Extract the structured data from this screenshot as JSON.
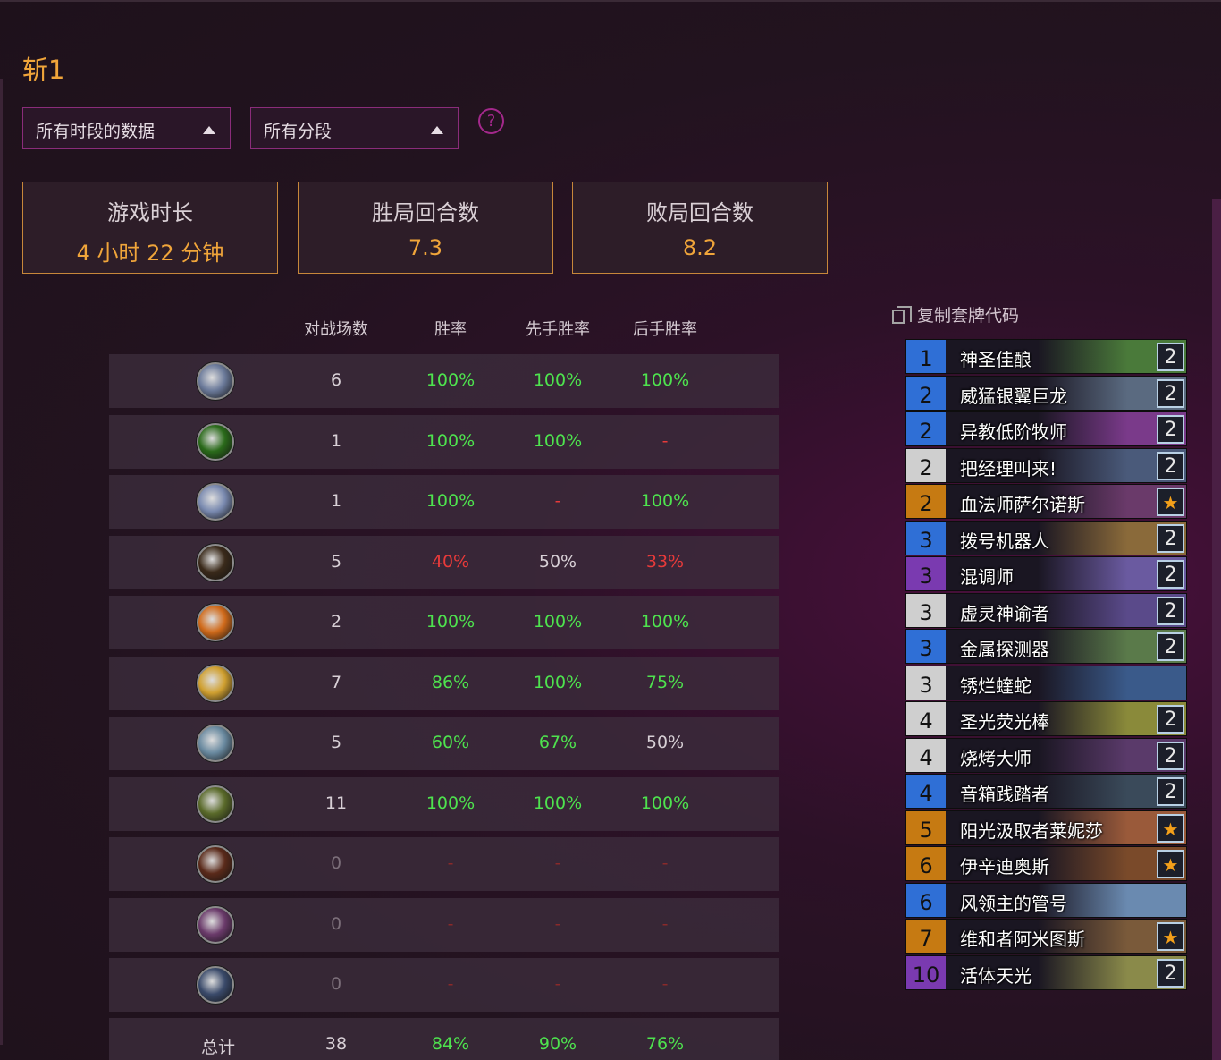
{
  "deck_title": "斩1",
  "filters": {
    "time_range": "所有时段的数据",
    "rank_range": "所有分段",
    "help_icon": "?"
  },
  "stats": [
    {
      "label": "游戏时长",
      "value": "4 小时 22 分钟"
    },
    {
      "label": "胜局回合数",
      "value": "7.3"
    },
    {
      "label": "败局回合数",
      "value": "8.2"
    }
  ],
  "table": {
    "headers": {
      "games": "对战场数",
      "winrate": "胜率",
      "first": "先手胜率",
      "second": "后手胜率"
    },
    "rows": [
      {
        "class_icon": "warrior-icon",
        "games": "6",
        "winrate": "100%",
        "first": "100%",
        "second": "100%",
        "wr_color": "green",
        "first_color": "green",
        "second_color": "green"
      },
      {
        "class_icon": "rogue-icon",
        "games": "1",
        "winrate": "100%",
        "first": "100%",
        "second": "-",
        "wr_color": "green",
        "first_color": "green",
        "second_color": "red"
      },
      {
        "class_icon": "shaman-icon",
        "games": "1",
        "winrate": "100%",
        "first": "-",
        "second": "100%",
        "wr_color": "green",
        "first_color": "red",
        "second_color": "green"
      },
      {
        "class_icon": "hunter-icon",
        "games": "5",
        "winrate": "40%",
        "first": "50%",
        "second": "33%",
        "wr_color": "red",
        "first_color": "white",
        "second_color": "red"
      },
      {
        "class_icon": "mage-icon",
        "games": "2",
        "winrate": "100%",
        "first": "100%",
        "second": "100%",
        "wr_color": "green",
        "first_color": "green",
        "second_color": "green"
      },
      {
        "class_icon": "paladin-icon",
        "games": "7",
        "winrate": "86%",
        "first": "100%",
        "second": "75%",
        "wr_color": "green",
        "first_color": "green",
        "second_color": "green"
      },
      {
        "class_icon": "priest-icon",
        "games": "5",
        "winrate": "60%",
        "first": "67%",
        "second": "50%",
        "wr_color": "green",
        "first_color": "green",
        "second_color": "white"
      },
      {
        "class_icon": "druid-icon",
        "games": "11",
        "winrate": "100%",
        "first": "100%",
        "second": "100%",
        "wr_color": "green",
        "first_color": "green",
        "second_color": "green"
      },
      {
        "class_icon": "warlock-icon",
        "games": "0",
        "winrate": "-",
        "first": "-",
        "second": "-",
        "wr_color": "dimred",
        "first_color": "dimred",
        "second_color": "dimred"
      },
      {
        "class_icon": "demonhunter-icon",
        "games": "0",
        "winrate": "-",
        "first": "-",
        "second": "-",
        "wr_color": "dimred",
        "first_color": "dimred",
        "second_color": "dimred"
      },
      {
        "class_icon": "deathknight-icon",
        "games": "0",
        "winrate": "-",
        "first": "-",
        "second": "-",
        "wr_color": "dimred",
        "first_color": "dimred",
        "second_color": "dimred"
      }
    ],
    "total": {
      "label": "总计",
      "games": "38",
      "winrate": "84%",
      "first": "90%",
      "second": "76%"
    }
  },
  "deck": {
    "copy_label": "复制套牌代码",
    "cards": [
      {
        "cost": "1",
        "name": "神圣佳酿",
        "count": "2",
        "rarity_color": "#2f6fd6",
        "art": "#4a7a3a"
      },
      {
        "cost": "2",
        "name": "威猛银翼巨龙",
        "count": "2",
        "rarity_color": "#2f6fd6",
        "art": "#5a6a80"
      },
      {
        "cost": "2",
        "name": "异教低阶牧师",
        "count": "2",
        "rarity_color": "#2f6fd6",
        "art": "#7a3a8a"
      },
      {
        "cost": "2",
        "name": "把经理叫来!",
        "count": "2",
        "rarity_color": "#cfcfcf",
        "art": "#4a5a7a"
      },
      {
        "cost": "2",
        "name": "血法师萨尔诺斯",
        "count": "★",
        "rarity_color": "#c67a12",
        "art": "#6a3a6a"
      },
      {
        "cost": "3",
        "name": "拨号机器人",
        "count": "2",
        "rarity_color": "#2f6fd6",
        "art": "#8a6a3a"
      },
      {
        "cost": "3",
        "name": "混调师",
        "count": "2",
        "rarity_color": "#7a3ab0",
        "art": "#6a5aa0"
      },
      {
        "cost": "3",
        "name": "虚灵神谕者",
        "count": "2",
        "rarity_color": "#cfcfcf",
        "art": "#5a4a8a"
      },
      {
        "cost": "3",
        "name": "金属探测器",
        "count": "2",
        "rarity_color": "#2f6fd6",
        "art": "#5a7a4a"
      },
      {
        "cost": "3",
        "name": "锈烂蝰蛇",
        "count": "",
        "rarity_color": "#cfcfcf",
        "art": "#3a5a8a"
      },
      {
        "cost": "4",
        "name": "圣光荧光棒",
        "count": "2",
        "rarity_color": "#cfcfcf",
        "art": "#8a8a3a"
      },
      {
        "cost": "4",
        "name": "烧烤大师",
        "count": "2",
        "rarity_color": "#cfcfcf",
        "art": "#5a3a6a"
      },
      {
        "cost": "4",
        "name": "音箱践踏者",
        "count": "2",
        "rarity_color": "#2f6fd6",
        "art": "#3a4a5a"
      },
      {
        "cost": "5",
        "name": "阳光汲取者莱妮莎",
        "count": "★",
        "rarity_color": "#c67a12",
        "art": "#9a5a3a"
      },
      {
        "cost": "6",
        "name": "伊辛迪奥斯",
        "count": "★",
        "rarity_color": "#c67a12",
        "art": "#7a4a2a"
      },
      {
        "cost": "6",
        "name": "风领主的管号",
        "count": "",
        "rarity_color": "#2f6fd6",
        "art": "#6a8ab0"
      },
      {
        "cost": "7",
        "name": "维和者阿米图斯",
        "count": "★",
        "rarity_color": "#c67a12",
        "art": "#7a5a3a"
      },
      {
        "cost": "10",
        "name": "活体天光",
        "count": "2",
        "rarity_color": "#7a3ab0",
        "art": "#8a8a4a"
      }
    ]
  }
}
